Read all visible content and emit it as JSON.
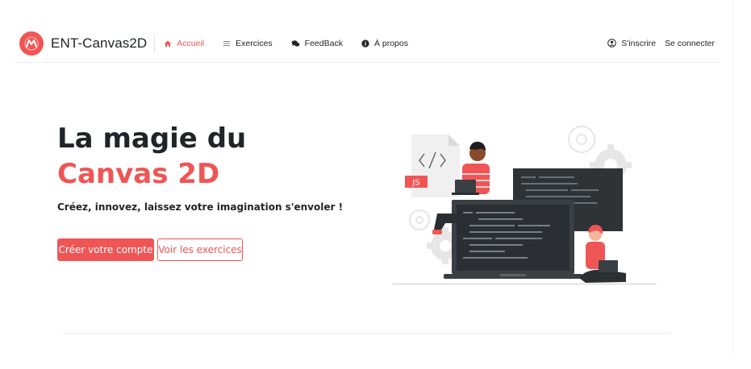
{
  "brand": {
    "name": "ENT-Canvas2D",
    "logo_icon": "logo-m-icon",
    "accent": "#f05555"
  },
  "nav": {
    "items": [
      {
        "label": "Accueil",
        "icon": "home-icon",
        "active": true
      },
      {
        "label": "Exercices",
        "icon": "list-icon",
        "active": false
      },
      {
        "label": "FeedBack",
        "icon": "comments-icon",
        "active": false
      },
      {
        "label": "À propos",
        "icon": "info-icon",
        "active": false
      }
    ],
    "right": {
      "register_label": "S'inscrire",
      "register_icon": "user-circle-icon",
      "login_label": "Se connecter"
    }
  },
  "hero": {
    "title_line1": "La magie du",
    "title_line2": "Canvas 2D",
    "subtitle": "Créez, innovez, laissez votre imagination s'envoler !",
    "primary_button": "Créer votre compte",
    "secondary_button": "Voir les exercices",
    "illustration_badge": "JS"
  },
  "colors": {
    "accent": "#f05555",
    "dark": "#212529",
    "screen": "#2f3336"
  }
}
